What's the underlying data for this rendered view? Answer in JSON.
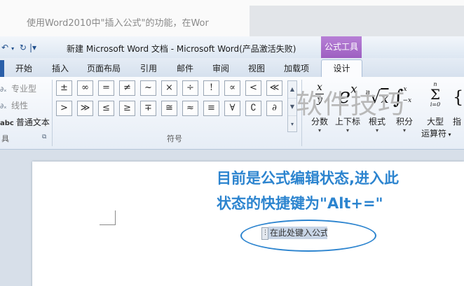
{
  "article": {
    "text": "使用Word2010中\"插入公式\"的功能，在Wor"
  },
  "window": {
    "title": "新建 Microsoft Word 文档 - Microsoft Word(产品激活失败)",
    "contextual_tab_title": "公式工具"
  },
  "tabs": [
    "开始",
    "插入",
    "页面布局",
    "引用",
    "邮件",
    "审阅",
    "视图",
    "加载项",
    "设计"
  ],
  "tools_group": {
    "items": [
      {
        "label": "专业型",
        "icon": "professional-icon"
      },
      {
        "label": "线性",
        "icon": "linear-icon"
      },
      {
        "label": "普通文本",
        "icon": "normal-text-icon",
        "prefix": "abc"
      }
    ],
    "group_label": "具"
  },
  "symbols": {
    "row1": [
      "±",
      "∞",
      "=",
      "≠",
      "~",
      "×",
      "÷",
      "!",
      "∝",
      "<",
      "≪"
    ],
    "row2": [
      ">",
      "≫",
      "≤",
      "≥",
      "∓",
      "≅",
      "≈",
      "≡",
      "∀",
      "∁",
      "∂"
    ],
    "group_label": "符号"
  },
  "structures": [
    {
      "label": "分数",
      "icon": "fraction-icon"
    },
    {
      "label": "上下标",
      "icon": "script-icon"
    },
    {
      "label": "根式",
      "icon": "radical-icon"
    },
    {
      "label": "积分",
      "icon": "integral-icon"
    },
    {
      "label": "大型",
      "label2": "运算符",
      "icon": "large-operator-icon"
    },
    {
      "label": "指",
      "icon": "bracket-icon"
    }
  ],
  "document": {
    "annotation_line1": "目前是公式编辑状态,进入此",
    "annotation_line2": "状态的快捷键为\"Alt+=\"",
    "equation_placeholder": "在此处键入公式。",
    "watermark": "软件技巧"
  },
  "colors": {
    "annotation": "#2c84cf",
    "contextual_tab": "#9d5fc1",
    "ribbon_bg": "#f4f7fb"
  }
}
